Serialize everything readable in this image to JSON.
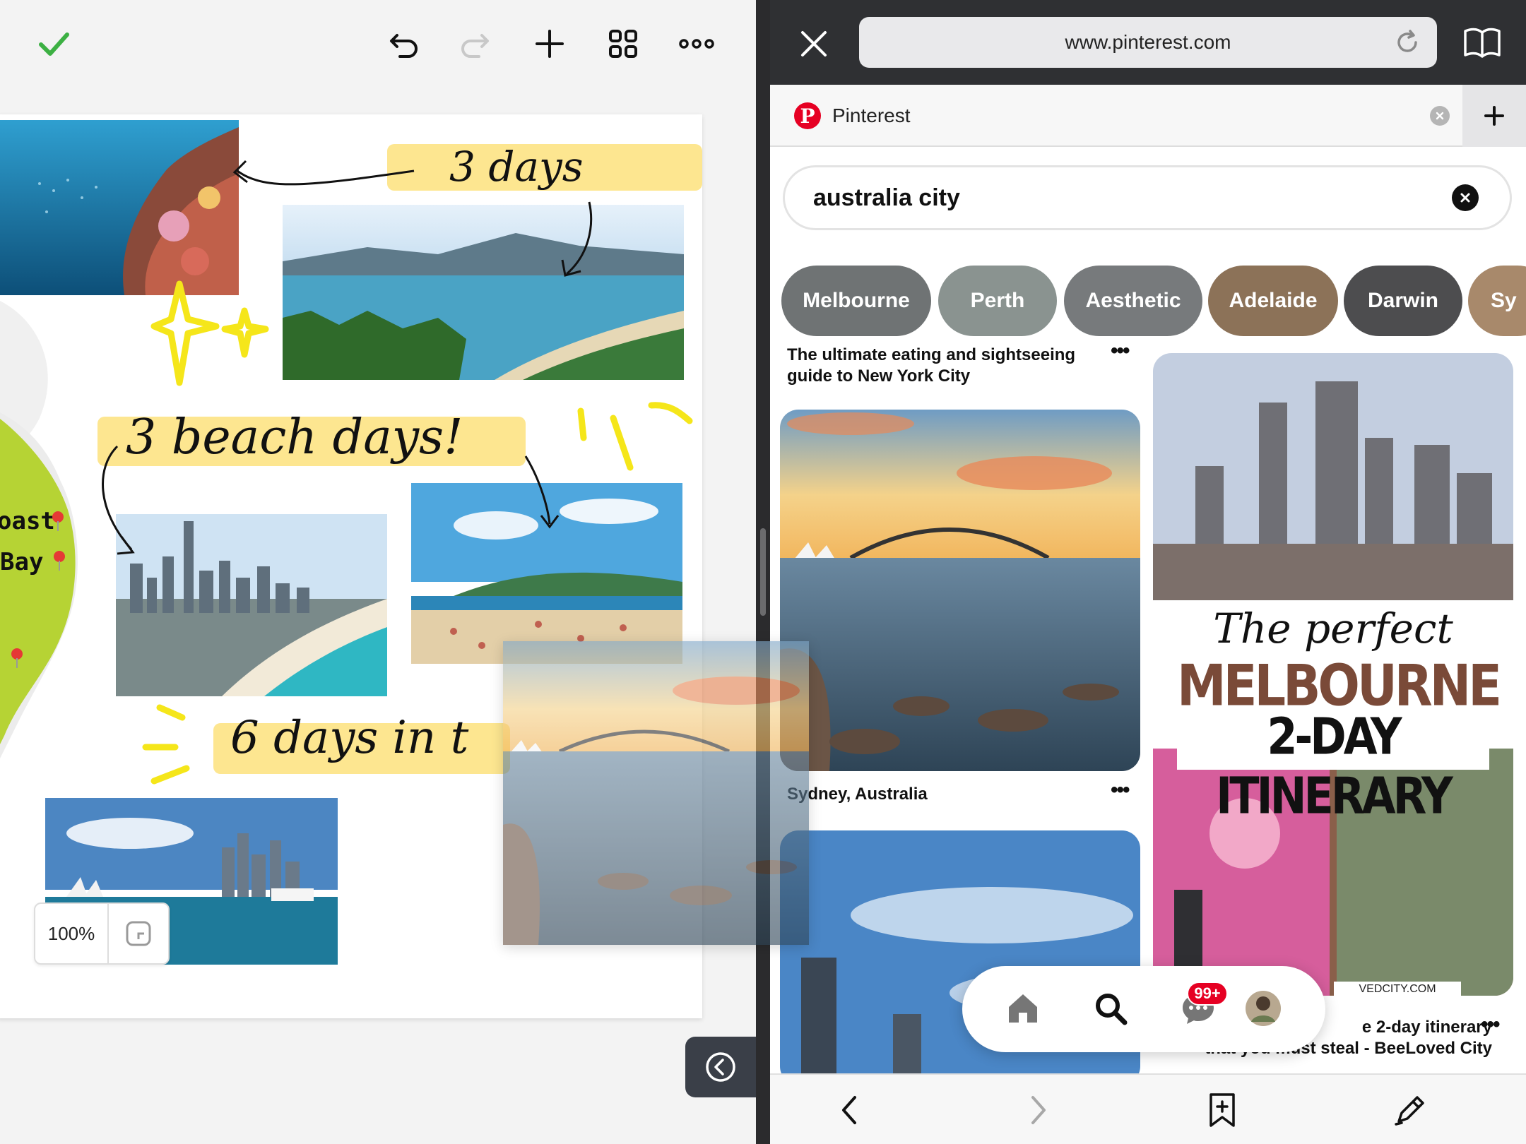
{
  "notes_app": {
    "toolbar": {
      "done_icon": "checkmark-icon",
      "undo_icon": "undo-icon",
      "redo_icon": "redo-icon",
      "add_icon": "plus-icon",
      "grid_icon": "grid-icon",
      "more_icon": "more-icon",
      "accent_color": "#3cb043"
    },
    "canvas": {
      "annotations": {
        "three_days": "3 days",
        "three_beach_days": "3 beach days!",
        "six_days": "6 days in t"
      },
      "map_labels": {
        "coast": "oast",
        "bay": "Bay"
      }
    },
    "zoom": {
      "value": "100%"
    },
    "collapse_icon": "chevron-left-circle-icon"
  },
  "browser": {
    "url": "www.pinterest.com",
    "tab": {
      "title": "Pinterest"
    },
    "search": {
      "query": "australia city"
    },
    "chips": [
      {
        "label": "Melbourne",
        "color": "#6f7374"
      },
      {
        "label": "Perth",
        "color": "#8a9390"
      },
      {
        "label": "Aesthetic",
        "color": "#777a7c"
      },
      {
        "label": "Adelaide",
        "color": "#8c7258"
      },
      {
        "label": "Darwin",
        "color": "#4d4d4f"
      },
      {
        "label": "Sy",
        "color": "#a8896b"
      }
    ],
    "pins": {
      "nyc_caption_line1": "The ultimate eating and sightseeing",
      "nyc_caption_line2": "guide to New York City",
      "sydney_caption": "Sydney, Australia",
      "melbourne_title_script": "The perfect",
      "melbourne_title_main": "MELBOURNE",
      "melbourne_title_sub": "2-DAY ITINERARY",
      "melbourne_watermark": "VEDCITY.COM",
      "melbourne_caption_line1": "e 2-day itinerary",
      "melbourne_caption_line2": "that you must steal - BeeLoved City"
    },
    "nav": {
      "badge": "99+"
    }
  }
}
